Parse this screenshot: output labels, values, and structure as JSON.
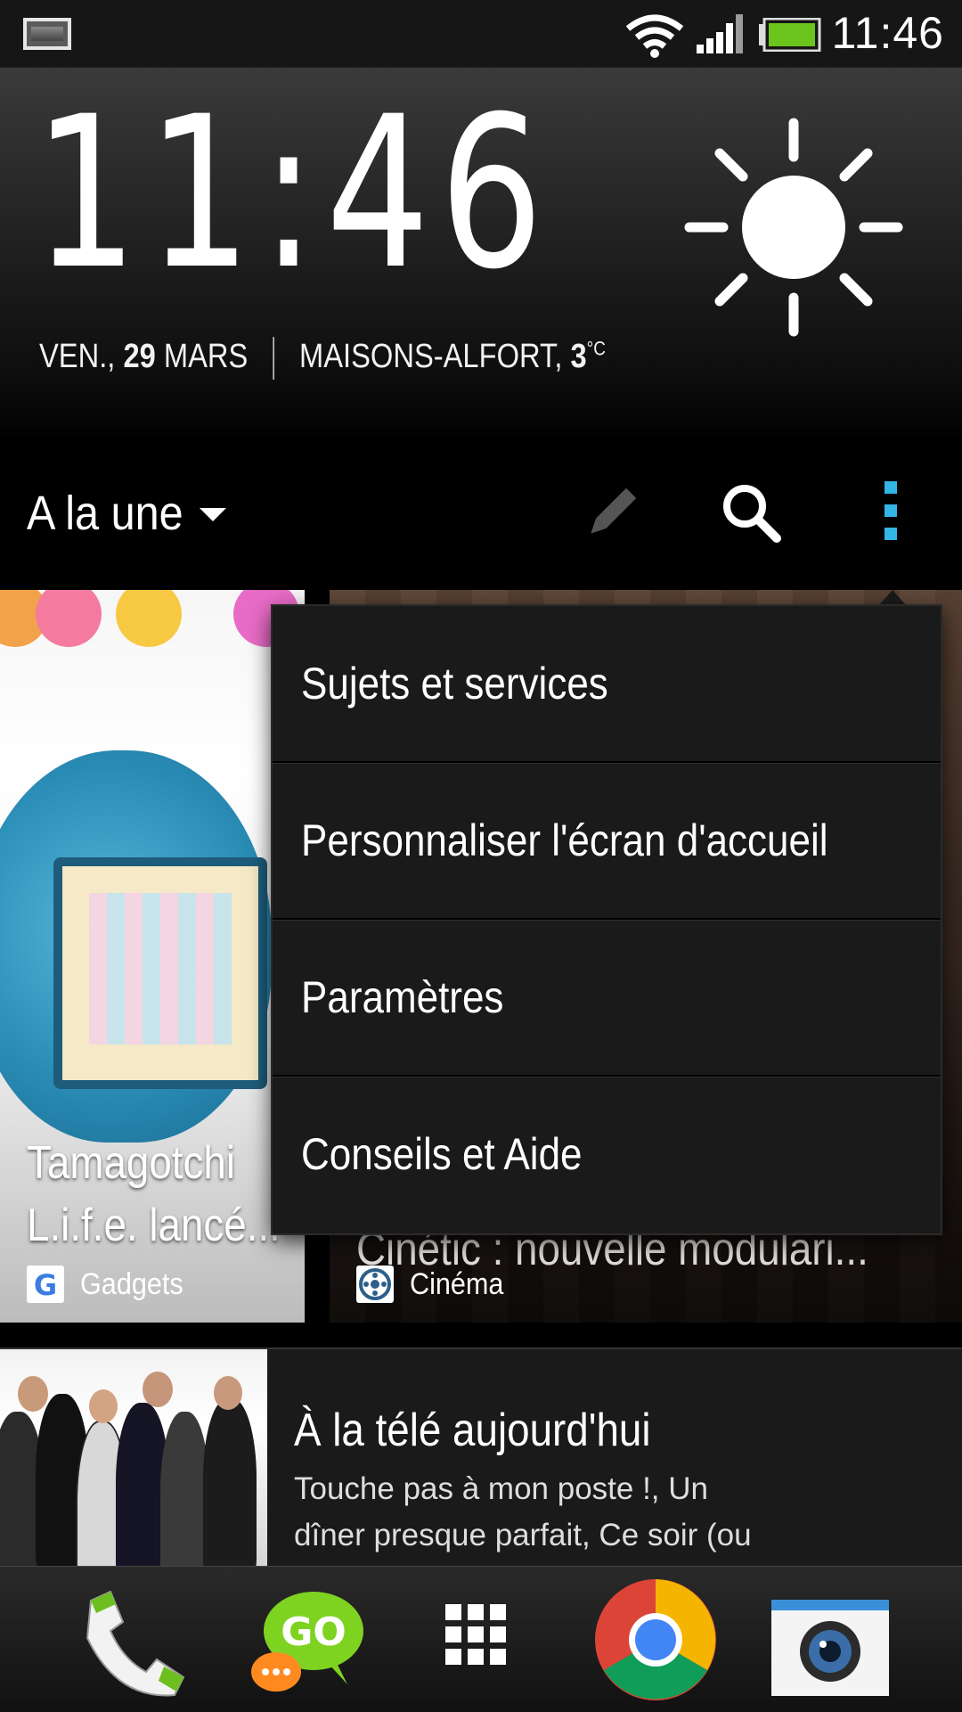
{
  "status_bar": {
    "time": "11:46",
    "icons": [
      "screenshot-notification-icon",
      "wifi-icon",
      "signal-icon",
      "battery-icon"
    ],
    "battery_color": "#6ac41c"
  },
  "clock_widget": {
    "time": "11:46",
    "date_prefix": "VEN., ",
    "date_day": "29",
    "date_month": " MARS",
    "location": "MAISONS-ALFORT, ",
    "temperature": "3",
    "temperature_unit": "°C",
    "weather_icon": "sun-icon"
  },
  "toolbar": {
    "section_title": "A la une",
    "icons": [
      "pencil-icon",
      "search-icon",
      "overflow-menu-icon"
    ],
    "accent_color": "#33b5e5"
  },
  "cards": [
    {
      "title_line1": "Tamagotchi",
      "title_line2": "L.i.f.e. lancé...",
      "source": "Gadgets",
      "source_icon": "google-g-icon"
    },
    {
      "title": "Cinétic : nouvelle modulari...",
      "source": "Cinéma",
      "source_icon": "film-reel-icon"
    }
  ],
  "news_item": {
    "title": "À la télé aujourd'hui",
    "body": "Touche pas à mon poste !, Un dîner presque parfait, Ce soir (ou jamais !),"
  },
  "overflow_menu": {
    "items": [
      {
        "label": "Sujets et services"
      },
      {
        "label": "Personnaliser l'écran d'accueil"
      },
      {
        "label": "Paramètres"
      },
      {
        "label": "Conseils et Aide"
      }
    ]
  },
  "dock": {
    "apps": [
      "phone-icon",
      "go-sms-icon",
      "app-drawer-icon",
      "chrome-icon",
      "camera-icon"
    ]
  }
}
